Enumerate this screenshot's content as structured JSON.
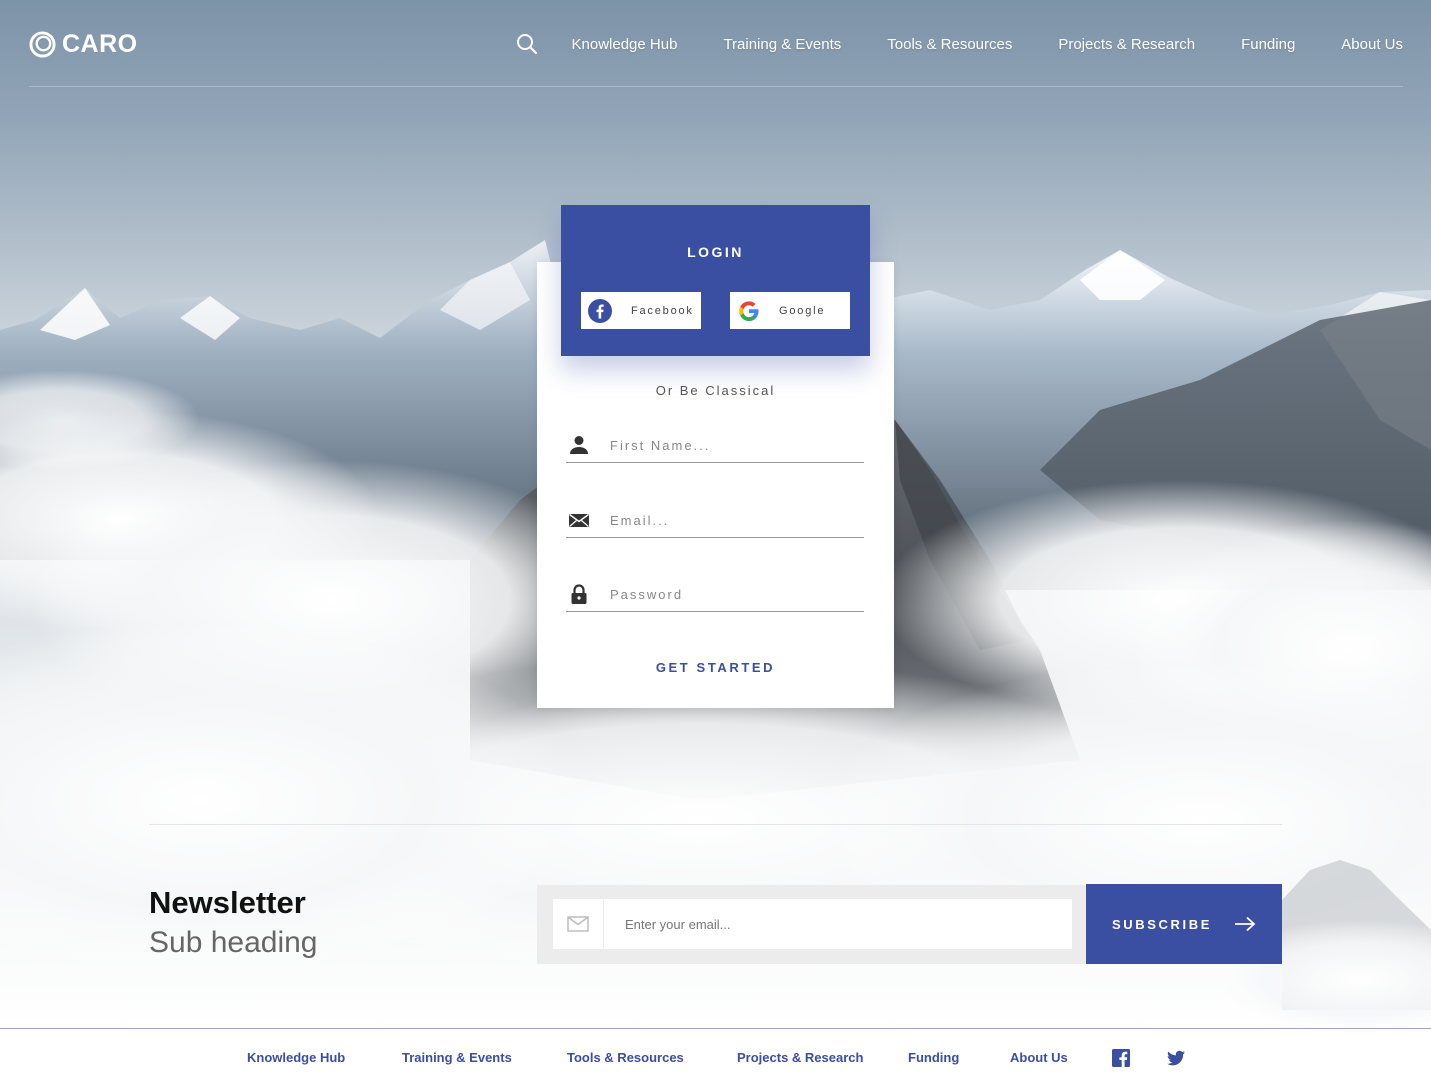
{
  "brand": {
    "name": "CARO"
  },
  "nav": {
    "items": [
      "Knowledge Hub",
      "Training & Events",
      "Tools & Resources",
      "Projects & Research",
      "Funding",
      "About Us"
    ],
    "search_icon": "search-icon"
  },
  "login": {
    "title": "LOGIN",
    "facebook_label": "Facebook",
    "google_label": "Google",
    "or_text": "Or Be Classical",
    "first_name_placeholder": "First Name...",
    "email_placeholder": "Email...",
    "password_placeholder": "Password",
    "submit_label": "GET STARTED"
  },
  "newsletter": {
    "title": "Newsletter",
    "subtitle": "Sub heading",
    "email_placeholder": "Enter your email...",
    "subscribe_label": "SUBSCRIBE"
  },
  "footer": {
    "links": [
      "Knowledge Hub",
      "Training & Events",
      "Tools & Resources",
      "Projects & Research",
      "Funding",
      "About Us"
    ],
    "social": [
      "facebook-icon",
      "twitter-icon"
    ]
  },
  "colors": {
    "accent": "#3a4ea2",
    "white": "#ffffff",
    "field_bg": "#ececec"
  }
}
